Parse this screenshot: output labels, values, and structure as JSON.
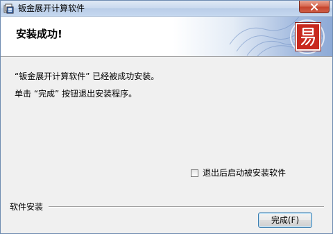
{
  "window": {
    "title": "钣金展开计算软件",
    "close_icon": "close-icon",
    "app_icon": "installer-app-icon"
  },
  "header": {
    "title": "安装成功!",
    "logo_glyph": "易",
    "logo_color": "#c8281e"
  },
  "body": {
    "message_line1": "“钣金展开计算软件” 已经被成功安装。",
    "message_line2": "单击 “完成” 按钮退出安装程序。"
  },
  "options": {
    "exit_checkbox_label": "退出后启动被安装软件",
    "exit_checkbox_checked": false
  },
  "footer": {
    "group_label": "软件安装",
    "finish_button_label": "完成(F)"
  },
  "colors": {
    "title_bar": "#c9d9ee",
    "close_button": "#c5452d",
    "header_gradient_end": "#8eaad6",
    "button_border": "#3c7fb1"
  }
}
